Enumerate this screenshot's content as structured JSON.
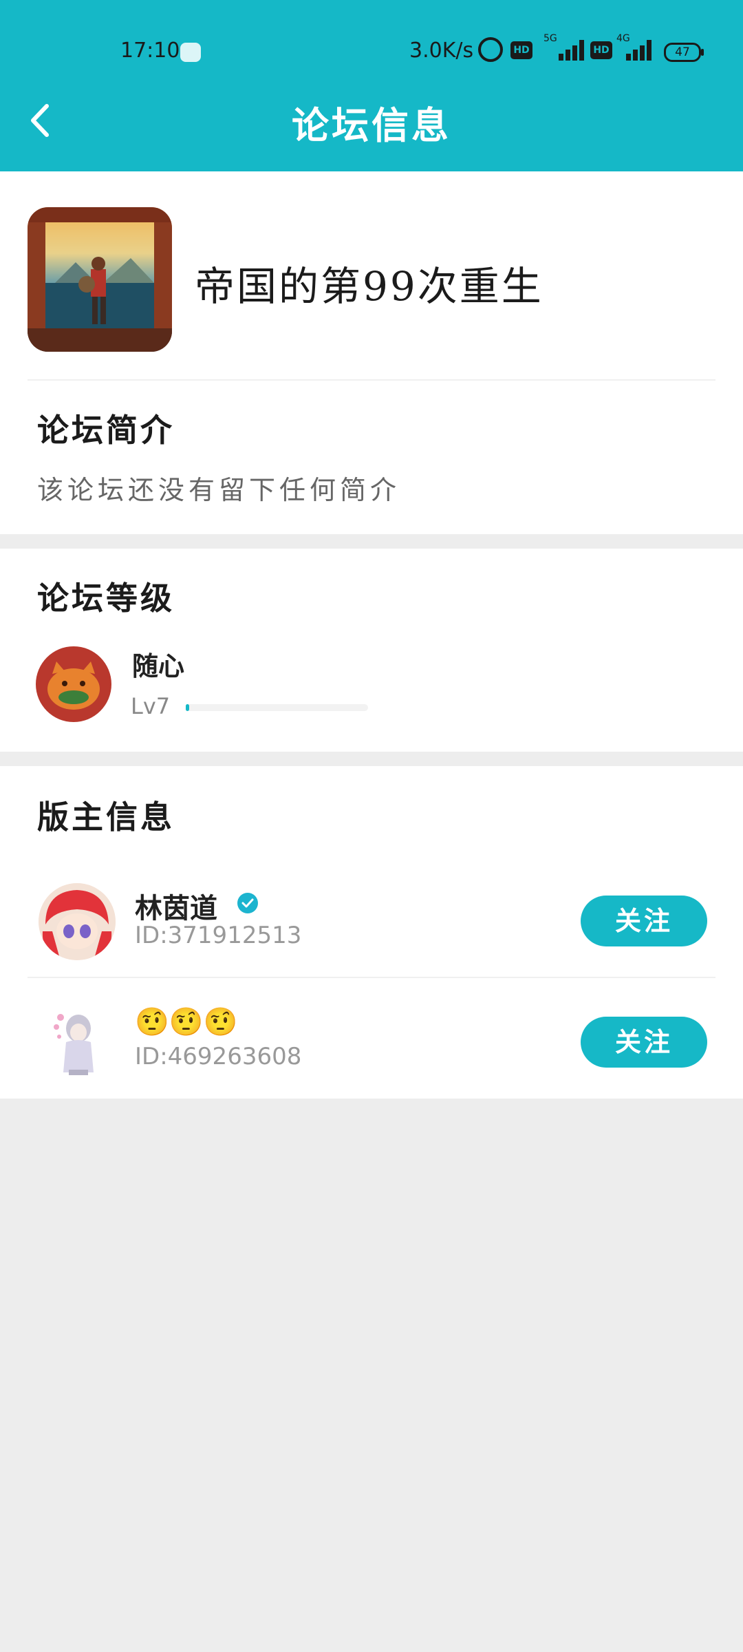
{
  "status_bar": {
    "time": "17:10",
    "network_speed": "3.0K/s",
    "hd1": "HD",
    "net1": "5G",
    "hd2": "HD",
    "net2": "4G",
    "battery": "47"
  },
  "header": {
    "title": "论坛信息",
    "back_icon": "chevron-left-icon"
  },
  "forum": {
    "name": "帝国的第99次重生"
  },
  "intro_section": {
    "title": "论坛简介",
    "text": "该论坛还没有留下任何简介"
  },
  "level_section": {
    "title": "论坛等级",
    "name": "随心",
    "level": "Lv7",
    "progress": 0.02
  },
  "moderators_section": {
    "title": "版主信息",
    "items": [
      {
        "name": "林茵道",
        "id": "ID:371912513",
        "verified": true,
        "follow": "关注"
      },
      {
        "name": "🤨🤨🤨",
        "id": "ID:469263608",
        "verified": false,
        "follow": "关注"
      }
    ]
  },
  "colors": {
    "accent": "#15b8c7",
    "background": "#ededed"
  }
}
